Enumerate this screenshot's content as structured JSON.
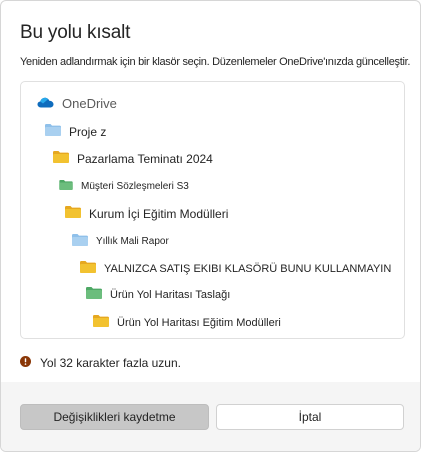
{
  "dialog": {
    "title": "Bu yolu kısalt",
    "subtitle": "Yeniden adlandırmak için bir klasör seçin. Düzenlemeler OneDrive'ınızda güncelleştir."
  },
  "tree": {
    "root_label": "OneDrive",
    "items": [
      {
        "label": "Proje z",
        "icon": "folder-blue-icon"
      },
      {
        "label": "Pazarlama Teminatı 2024",
        "icon": "folder-yellow-icon"
      },
      {
        "label": "Müşteri Sözleşmeleri S3",
        "icon": "folder-green-icon"
      },
      {
        "label": "Kurum İçi Eğitim Modülleri",
        "icon": "folder-yellow-icon"
      },
      {
        "label": "Yıllık Mali Rapor",
        "icon": "folder-blue-icon"
      },
      {
        "label": "YALNIZCA SATIŞ EKIBI KLASÖRÜ BUNU KULLANMAYIN",
        "icon": "folder-yellow-icon"
      },
      {
        "label": "Ürün Yol Haritası Taslağı",
        "icon": "folder-green-icon"
      },
      {
        "label": "Ürün Yol Haritası Eğitim Modülleri",
        "icon": "folder-yellow-icon"
      }
    ]
  },
  "warning": {
    "text": "Yol 32 karakter fazla uzun.",
    "icon": "warning-icon",
    "color": "#8a3707"
  },
  "footer": {
    "primary_label": "Değişiklikleri kaydetme",
    "secondary_label": "İptal"
  },
  "colors": {
    "folder_yellow": "#f2c230",
    "folder_blue": "#8fc0ea",
    "folder_green": "#6cbd7d",
    "onedrive_blue": "#0f6cbd"
  }
}
